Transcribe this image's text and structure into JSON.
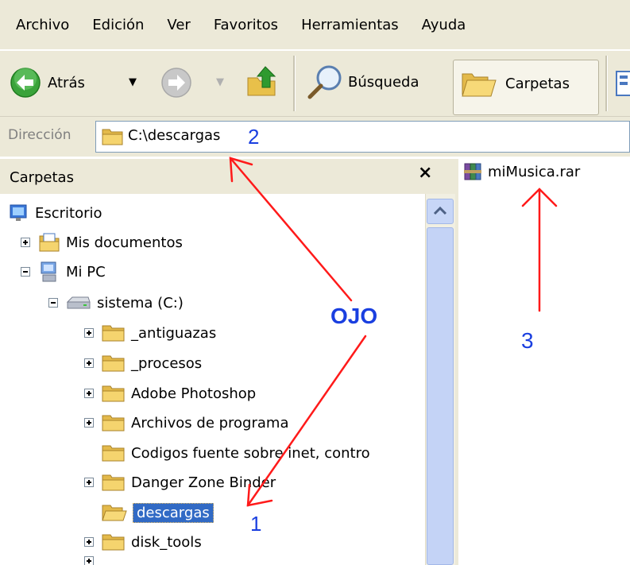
{
  "menu": {
    "items": [
      "Archivo",
      "Edición",
      "Ver",
      "Favoritos",
      "Herramientas",
      "Ayuda"
    ]
  },
  "toolbar": {
    "back_label": "Atrás",
    "search_label": "Búsqueda",
    "folders_label": "Carpetas"
  },
  "address": {
    "label": "Dirección",
    "value": "C:\\descargas"
  },
  "folders_panel": {
    "title": "Carpetas",
    "close": "×"
  },
  "tree": {
    "items": [
      {
        "label": "Escritorio",
        "icon": "desktop-icon"
      },
      {
        "label": "Mis documentos",
        "icon": "documents-icon",
        "expander": "plus"
      },
      {
        "label": "Mi PC",
        "icon": "computer-icon",
        "expander": "minus"
      },
      {
        "label": "sistema (C:)",
        "icon": "drive-icon",
        "expander": "minus"
      },
      {
        "label": "_antiguazas",
        "icon": "folder-icon",
        "expander": "plus"
      },
      {
        "label": "_procesos",
        "icon": "folder-icon",
        "expander": "plus"
      },
      {
        "label": "Adobe Photoshop",
        "icon": "folder-icon",
        "expander": "plus"
      },
      {
        "label": "Archivos de programa",
        "icon": "folder-icon",
        "expander": "plus"
      },
      {
        "label": "Codigos fuente sobre inet, contro",
        "icon": "folder-icon"
      },
      {
        "label": "Danger Zone Binder",
        "icon": "folder-icon",
        "expander": "plus"
      },
      {
        "label": "descargas",
        "icon": "folder-open-icon",
        "selected": true
      },
      {
        "label": "disk_tools",
        "icon": "folder-icon",
        "expander": "plus"
      }
    ]
  },
  "files": [
    {
      "name": "miMusica.rar",
      "icon": "rar-archive-icon"
    }
  ],
  "annotations": {
    "n1": "1",
    "n2": "2",
    "n3": "3",
    "ojo": "OJO"
  },
  "colors": {
    "chrome": "#ece9d8",
    "selection": "#316ac5",
    "annotation_text": "#1a3fe0",
    "annotation_arrow": "#ff1a1a"
  }
}
